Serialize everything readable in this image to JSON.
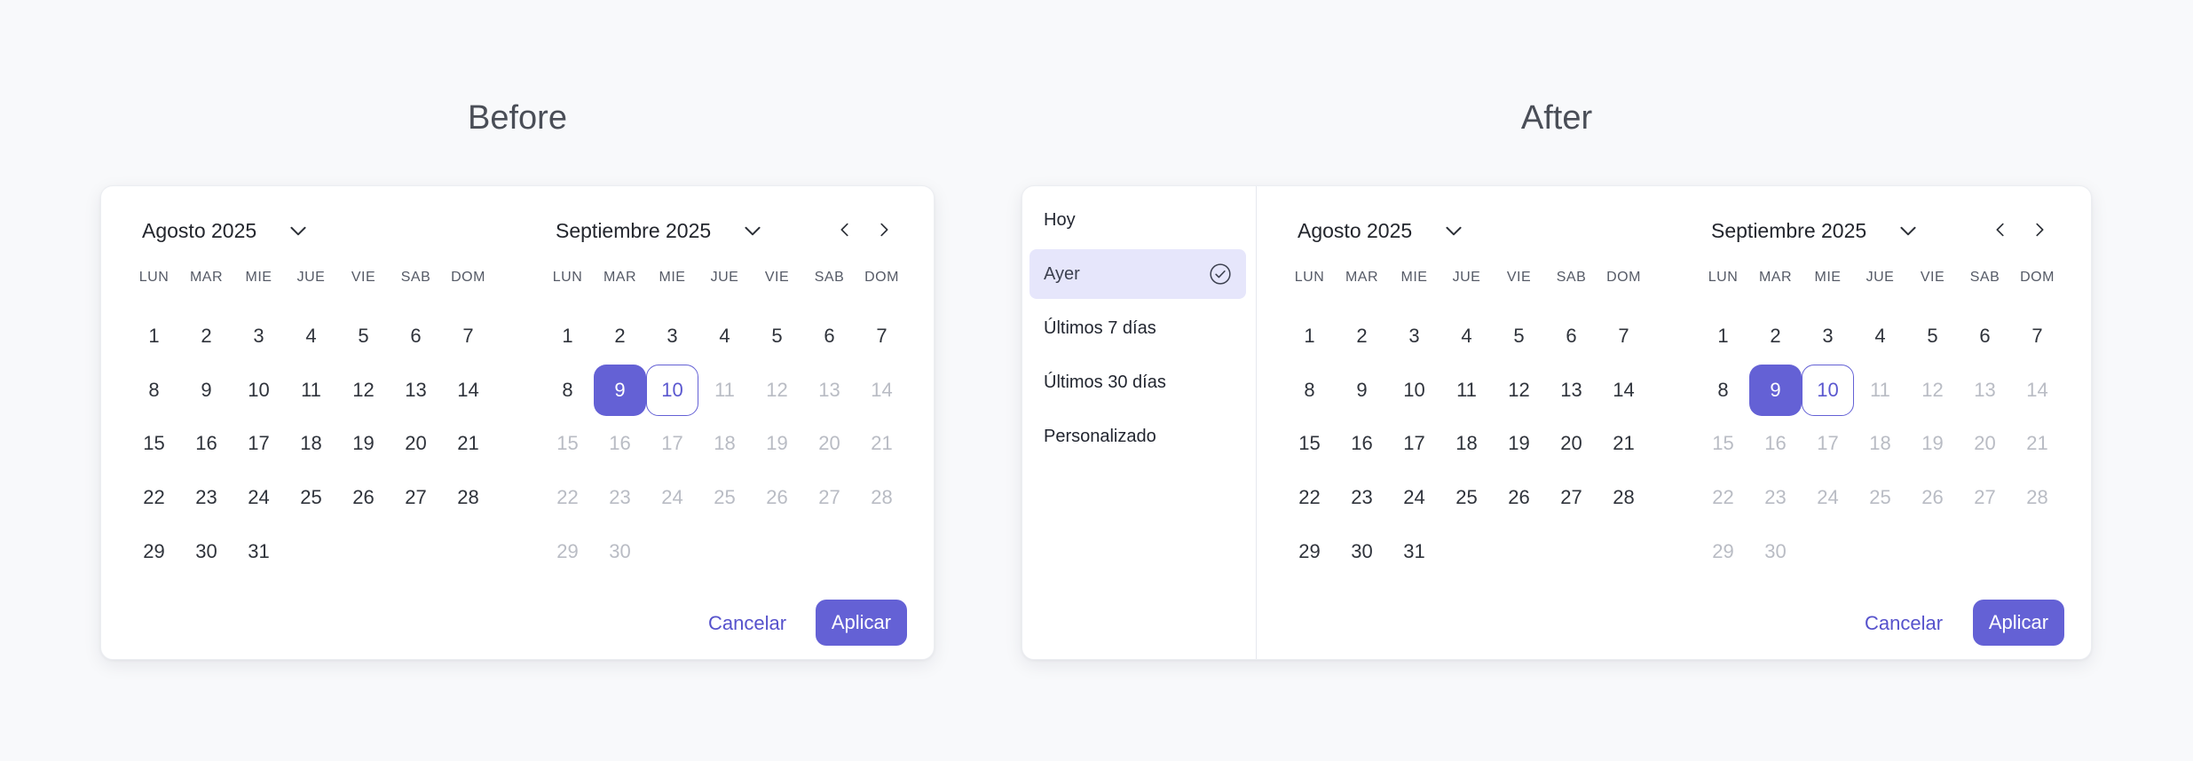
{
  "headings": {
    "before": "Before",
    "after": "After"
  },
  "weekdays": [
    "LUN",
    "MAR",
    "MIE",
    "JUE",
    "VIE",
    "SAB",
    "DOM"
  ],
  "months": {
    "aug": {
      "title": "Agosto 2025",
      "first_weekday_index": 0,
      "days_in_month": 31,
      "muted_from": 0,
      "selected": 0,
      "today": 0
    },
    "sep": {
      "title": "Septiembre 2025",
      "first_weekday_index": 0,
      "days_in_month": 30,
      "muted_from": 11,
      "selected": 9,
      "today": 10
    }
  },
  "presets": [
    {
      "label": "Hoy",
      "active": false
    },
    {
      "label": "Ayer",
      "active": true
    },
    {
      "label": "Últimos 7 días",
      "active": false
    },
    {
      "label": "Últimos 30 días",
      "active": false
    },
    {
      "label": "Personalizado",
      "active": false
    }
  ],
  "actions": {
    "cancel": "Cancelar",
    "apply": "Aplicar"
  },
  "icons": {
    "month_dropdown": "chevron-down-icon",
    "prev": "chevron-left-icon",
    "next": "chevron-right-icon",
    "active_preset": "check-circle-icon"
  },
  "colors": {
    "accent": "#6461d5",
    "accent_soft": "#e6e6fb",
    "muted_text": "#b9bcc4",
    "text": "#2f333b",
    "background": "#f8f9fb"
  }
}
